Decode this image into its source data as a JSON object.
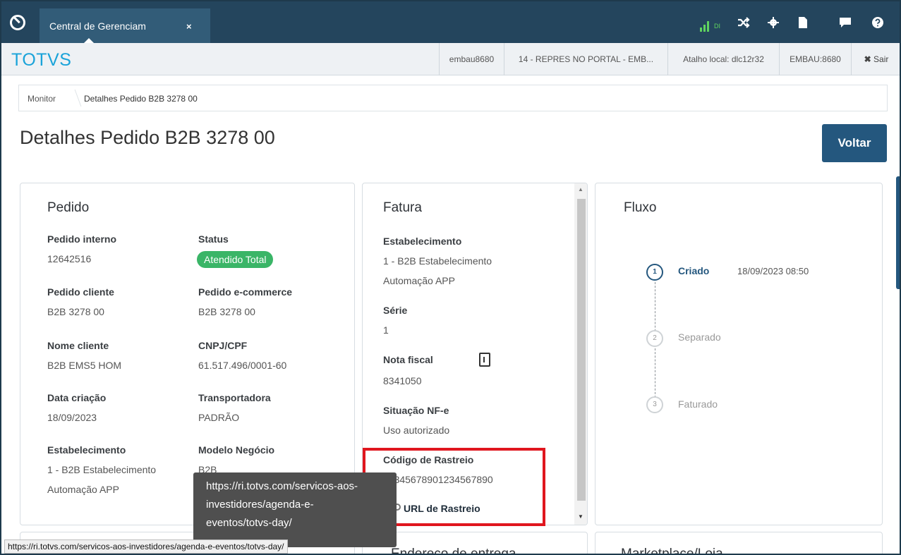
{
  "topbar": {
    "tab_label": "Central de Gerenciam",
    "tab_close": "×",
    "signal_text": "DI",
    "icons": [
      "logo-icon",
      "signal-icon",
      "shuffle-icon",
      "gear-icon",
      "document-icon",
      "chat-icon",
      "help-icon"
    ]
  },
  "header": {
    "brand": "TOTVS",
    "user": "embau8680",
    "company": "14 - REPRES NO PORTAL - EMB...",
    "shortcut": "Atalho local: dlc12r32",
    "server": "EMBAU:8680",
    "logout": "Sair"
  },
  "breadcrumb": {
    "item1": "Monitor",
    "item2": "Detalhes Pedido B2B 3278 00"
  },
  "page": {
    "title": "Detalhes Pedido B2B 3278 00",
    "back_label": "Voltar"
  },
  "pedido": {
    "title": "Pedido",
    "pedido_interno_label": "Pedido interno",
    "pedido_interno": "12642516",
    "status_label": "Status",
    "status": "Atendido Total",
    "pedido_cliente_label": "Pedido cliente",
    "pedido_cliente": "B2B 3278 00",
    "pedido_ecommerce_label": "Pedido e-commerce",
    "pedido_ecommerce": "B2B 3278 00",
    "nome_cliente_label": "Nome cliente",
    "nome_cliente": "B2B EMS5 HOM",
    "cnpj_label": "CNPJ/CPF",
    "cnpj": "61.517.496/0001-60",
    "data_criacao_label": "Data criação",
    "data_criacao": "18/09/2023",
    "transportadora_label": "Transportadora",
    "transportadora": "PADRÃO",
    "estabelecimento_label": "Estabelecimento",
    "estabelecimento_1": "1 - B2B Estabelecimento",
    "estabelecimento_2": "Automação APP",
    "modelo_label": "Modelo Negócio",
    "modelo": "B2B"
  },
  "fatura": {
    "title": "Fatura",
    "estabelecimento_label": "Estabelecimento",
    "estabelecimento_1": "1 - B2B Estabelecimento",
    "estabelecimento_2": "Automação APP",
    "serie_label": "Série",
    "serie": "1",
    "nota_label": "Nota fiscal",
    "nota": "8341050",
    "situacao_label": "Situação NF-e",
    "situacao": "Uso autorizado",
    "codigo_label": "Código de Rastreio",
    "codigo": "12345678901234567890",
    "url_label": "URL de Rastreio"
  },
  "fluxo": {
    "title": "Fluxo",
    "steps": [
      {
        "num": "1",
        "label": "Criado",
        "date": "18/09/2023 08:50"
      },
      {
        "num": "2",
        "label": "Separado"
      },
      {
        "num": "3",
        "label": "Faturado"
      }
    ]
  },
  "bottom": {
    "endereco_title": "Endereço de entrega",
    "marketplace_title": "Marketplace/Loja"
  },
  "tooltip": {
    "line1": "https://ri.totvs.com/servicos-aos-",
    "line2": "investidores/agenda-e-",
    "line3": "eventos/totvs-day/"
  },
  "statusbar": {
    "url": "https://ri.totvs.com/servicos-aos-investidores/agenda-e-eventos/totvs-day/"
  },
  "colors": {
    "topbar": "#24455d",
    "brand": "#1aa3d9",
    "primary": "#24577e",
    "success": "#3ab567",
    "highlight": "#e0161e"
  }
}
